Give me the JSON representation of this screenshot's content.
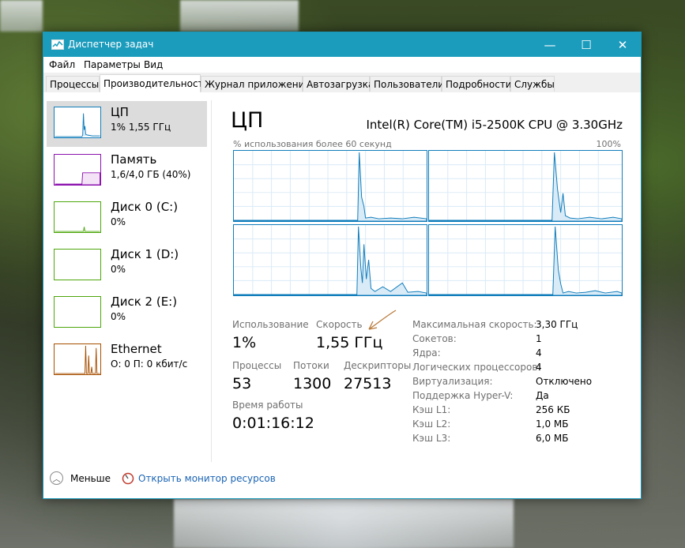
{
  "window": {
    "title": "Диспетчер задач",
    "controls": {
      "minimize": "—",
      "maximize": "☐",
      "close": "✕"
    }
  },
  "menu": [
    "Файл",
    "Параметры",
    "Вид"
  ],
  "tabs": [
    "Процессы",
    "Производительность",
    "Журнал приложений",
    "Автозагрузка",
    "Пользователи",
    "Подробности",
    "Службы"
  ],
  "active_tab": "Производительность",
  "sidebar": {
    "items": [
      {
        "title": "ЦП",
        "sub": "1% 1,55 ГГц",
        "color": "#117dbb"
      },
      {
        "title": "Память",
        "sub": "1,6/4,0 ГБ (40%)",
        "color": "#8b12ae"
      },
      {
        "title": "Диск 0 (C:)",
        "sub": "0%",
        "color": "#4da60c"
      },
      {
        "title": "Диск 1 (D:)",
        "sub": "0%",
        "color": "#4da60c"
      },
      {
        "title": "Диск 2 (E:)",
        "sub": "0%",
        "color": "#4da60c"
      },
      {
        "title": "Ethernet",
        "sub": "О: 0 П: 0 кбит/с",
        "color": "#a74f01"
      }
    ]
  },
  "cpu": {
    "heading": "ЦП",
    "model": "Intel(R) Core(TM) i5-2500K CPU @ 3.30GHz",
    "graph_caption": "% использования более 60 секунд",
    "graph_max": "100%",
    "line_color": "#117dbb",
    "stats": {
      "utilization_label": "Использование",
      "utilization": "1%",
      "speed_label": "Скорость",
      "speed": "1,55 ГГц",
      "processes_label": "Процессы",
      "processes": "53",
      "threads_label": "Потоки",
      "threads": "1300",
      "handles_label": "Дескрипторы",
      "handles": "27513",
      "uptime_label": "Время работы",
      "uptime": "0:01:16:12"
    },
    "props": [
      {
        "k": "Максимальная скорость:",
        "v": "3,30 ГГц"
      },
      {
        "k": "Сокетов:",
        "v": "1"
      },
      {
        "k": "Ядра:",
        "v": "4"
      },
      {
        "k": "Логических процессоров:",
        "v": "4"
      },
      {
        "k": "Виртуализация:",
        "v": "Отключено"
      },
      {
        "k": "Поддержка Hyper-V:",
        "v": "Да"
      },
      {
        "k": "Кэш L1:",
        "v": "256 КБ"
      },
      {
        "k": "Кэш L2:",
        "v": "1,0 МБ"
      },
      {
        "k": "Кэш L3:",
        "v": "6,0 МБ"
      }
    ]
  },
  "footer": {
    "fewer": "Меньше",
    "monitor": "Открыть монитор ресурсов"
  }
}
